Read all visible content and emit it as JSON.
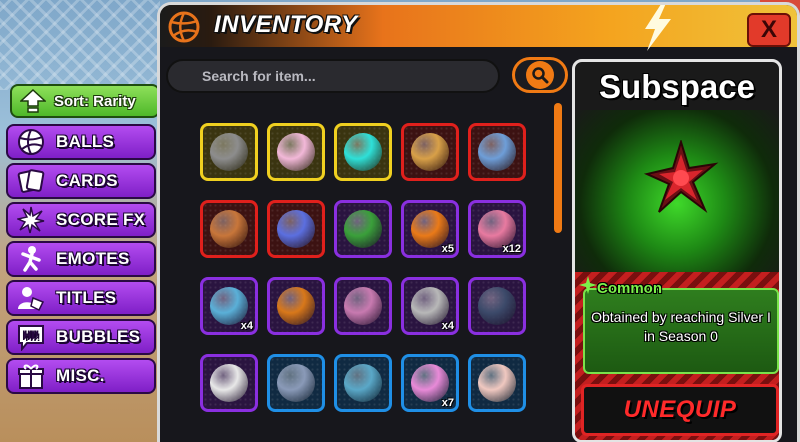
{
  "header": {
    "title": "INVENTORY",
    "close_label": "X"
  },
  "search": {
    "placeholder": "Search for item..."
  },
  "sidebar": {
    "sort_label": "Sort: Rarity",
    "items": [
      {
        "label": "BALLS",
        "icon": "volleyball-icon"
      },
      {
        "label": "CARDS",
        "icon": "cards-icon"
      },
      {
        "label": "SCORE FX",
        "icon": "burst-icon"
      },
      {
        "label": "EMOTES",
        "icon": "dancer-icon"
      },
      {
        "label": "TITLES",
        "icon": "person-tag-icon"
      },
      {
        "label": "BUBBLES",
        "icon": "speech-bubble-icon"
      },
      {
        "label": "MISC.",
        "icon": "gift-icon"
      }
    ]
  },
  "inventory": {
    "rows": [
      [
        {
          "rarity": "gold",
          "color": "#8d8d8d",
          "qty": ""
        },
        {
          "rarity": "gold",
          "color": "#f2b8d8",
          "qty": ""
        },
        {
          "rarity": "gold",
          "color": "#2ee0d8",
          "qty": ""
        },
        {
          "rarity": "red",
          "color": "#d8a048",
          "qty": ""
        },
        {
          "rarity": "red",
          "color": "#6e9ed8",
          "qty": ""
        }
      ],
      [
        {
          "rarity": "red",
          "color": "#c8763a",
          "qty": ""
        },
        {
          "rarity": "red",
          "color": "#5b6fe0",
          "qty": ""
        },
        {
          "rarity": "purple",
          "color": "#3aa03a",
          "qty": ""
        },
        {
          "rarity": "purple",
          "color": "#ea7a18",
          "qty": "x5"
        },
        {
          "rarity": "purple",
          "color": "#e87aa0",
          "qty": "x12"
        }
      ],
      [
        {
          "rarity": "purple",
          "color": "#5ab0d8",
          "qty": "x4"
        },
        {
          "rarity": "purple",
          "color": "#d8781a",
          "qty": ""
        },
        {
          "rarity": "purple",
          "color": "#c87ab0",
          "qty": ""
        },
        {
          "rarity": "purple",
          "color": "#b8b8b8",
          "qty": "x4"
        },
        {
          "rarity": "purple",
          "color": "#3c4a6a",
          "qty": ""
        }
      ],
      [
        {
          "rarity": "purple",
          "color": "#e8e8e8",
          "qty": ""
        },
        {
          "rarity": "blue",
          "color": "#8a9ab8",
          "qty": ""
        },
        {
          "rarity": "blue",
          "color": "#5aa8c8",
          "qty": ""
        },
        {
          "rarity": "blue",
          "color": "#e88ad8",
          "qty": "x7"
        },
        {
          "rarity": "blue",
          "color": "#f0c8c0",
          "qty": ""
        }
      ]
    ]
  },
  "detail": {
    "name": "Subspace",
    "rarity": "Common",
    "description": "Obtained by reaching Silver I in Season 0",
    "unequip_label": "UNEQUIP"
  }
}
